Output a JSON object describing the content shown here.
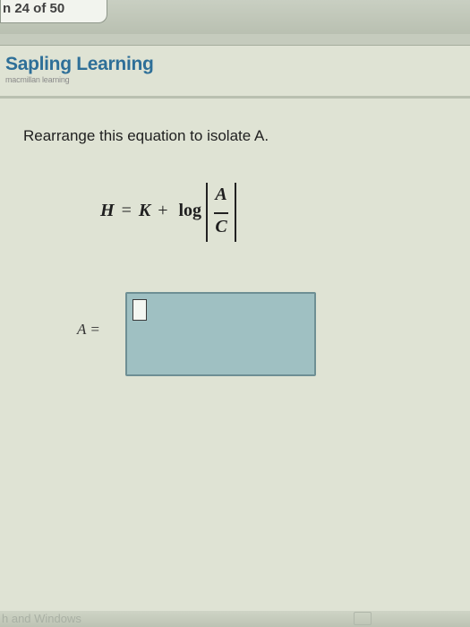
{
  "header": {
    "question_counter": "n 24 of 50"
  },
  "brand": {
    "title": "Sapling Learning",
    "subtitle": "macmillan learning"
  },
  "question": {
    "prompt": "Rearrange this equation to isolate A.",
    "equation": {
      "lhs": "H",
      "equals": "=",
      "term1": "K",
      "plus": "+",
      "function": "log",
      "numerator": "A",
      "denominator": "C"
    },
    "answer_label": "A ="
  },
  "footer": {
    "partial_text": "h and Windows"
  },
  "colors": {
    "brand_blue": "#2e6f98",
    "answer_box": "#9fc0c2"
  },
  "icons": [
    "window-icon"
  ]
}
